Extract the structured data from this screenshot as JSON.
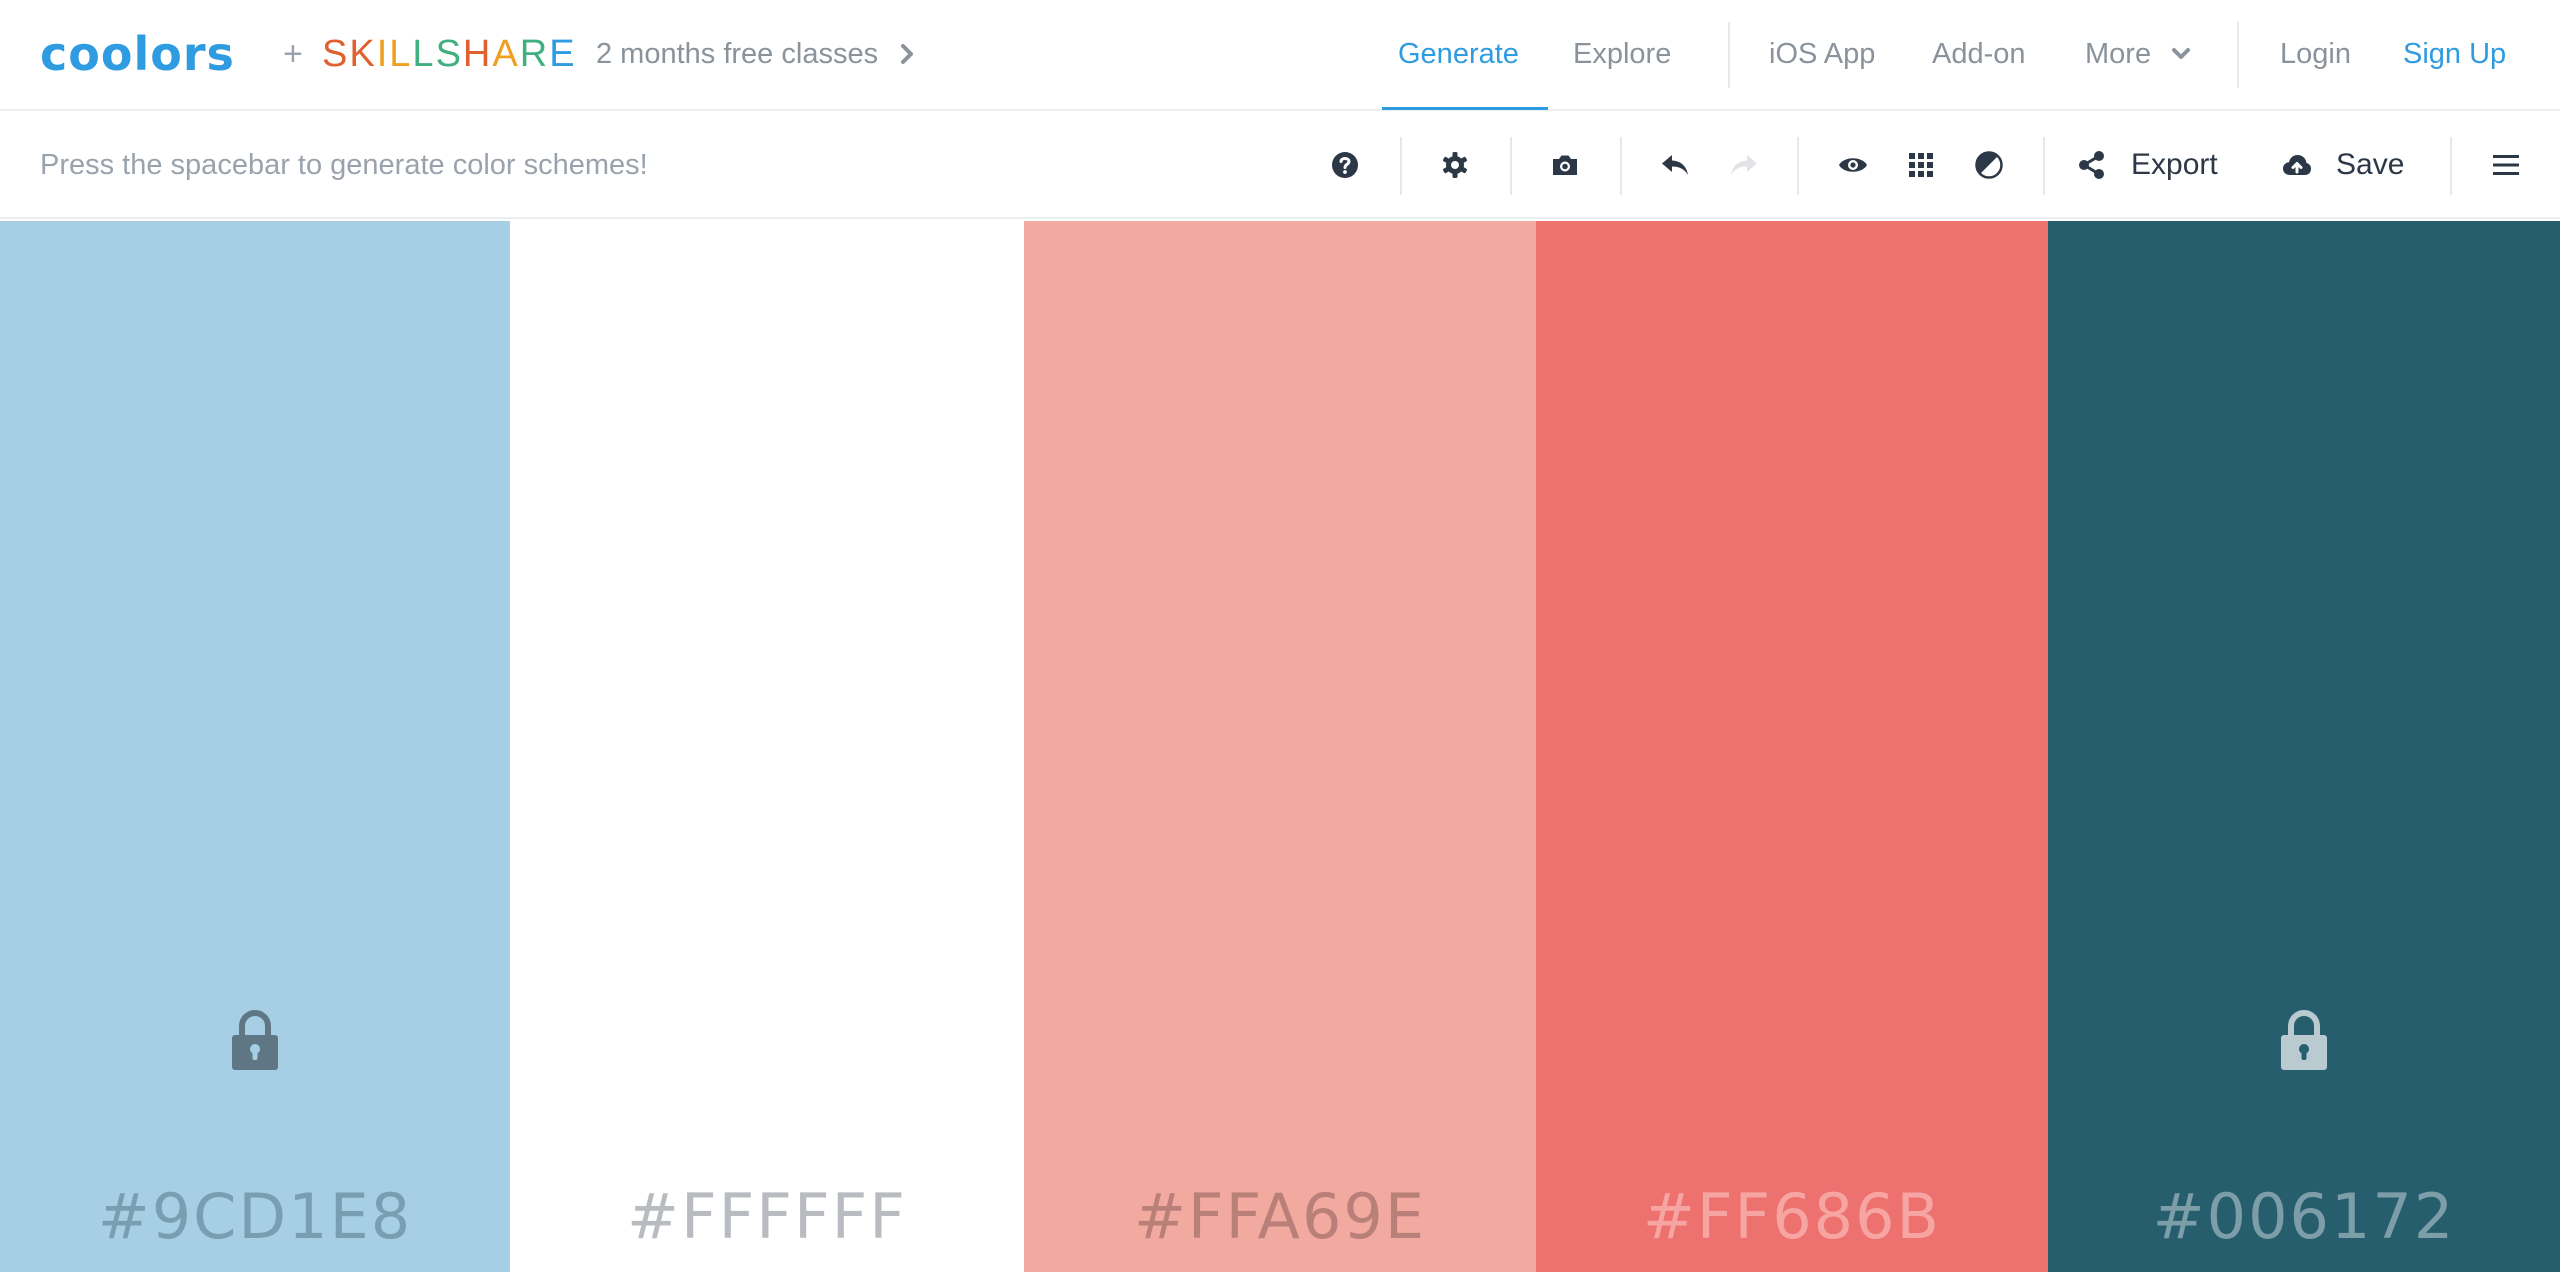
{
  "header": {
    "logo": "coolors",
    "plus": "+",
    "partner": [
      "S",
      "K",
      "I",
      "L",
      "L",
      "S",
      "H",
      "A",
      "R",
      "E"
    ],
    "partner_colors": [
      "#e0602f",
      "#e0602f",
      "#f0a020",
      "#f0a020",
      "#40b080",
      "#40b080",
      "#e0602f",
      "#f0a020",
      "#40b080",
      "#2f9be0"
    ],
    "promo": "2 months free classes",
    "nav": {
      "generate": "Generate",
      "explore": "Explore",
      "ios": "iOS App",
      "addon": "Add-on",
      "more": "More",
      "login": "Login",
      "signup": "Sign Up"
    }
  },
  "toolbar": {
    "hint": "Press the spacebar to generate color schemes!",
    "export": "Export",
    "save": "Save",
    "icons": [
      "help-icon",
      "settings-icon",
      "camera-icon",
      "undo-icon",
      "redo-icon",
      "eye-icon",
      "grid-icon",
      "contrast-icon",
      "share-icon",
      "cloud-upload-icon",
      "menu-icon"
    ]
  },
  "palette": [
    {
      "hex": "#9CD1E8",
      "bg": "#a6cfe6",
      "text": "#7a9eb1",
      "locked": true,
      "lock_color": "#5f7684"
    },
    {
      "hex": "#FFFFFF",
      "bg": "#ffffff",
      "text": "#b8bcc0",
      "locked": false
    },
    {
      "hex": "#FFA69E",
      "bg": "#f1a9a0",
      "text": "#b98079",
      "locked": false
    },
    {
      "hex": "#FF686B",
      "bg": "#ed716e",
      "text": "#f6a5a2",
      "locked": false
    },
    {
      "hex": "#006172",
      "bg": "#265e6e",
      "text": "#7d9ea8",
      "locked": true,
      "lock_color": "#b9cbd1"
    }
  ],
  "colors": {
    "accent": "#2f9be0",
    "muted": "#8a939c",
    "dark": "#2c3846"
  }
}
